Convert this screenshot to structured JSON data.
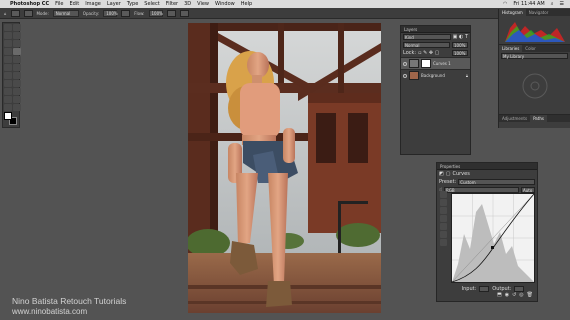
{
  "menubar": {
    "apple": "",
    "app_name": "Photoshop CC",
    "items": [
      "File",
      "Edit",
      "Image",
      "Layer",
      "Type",
      "Select",
      "Filter",
      "3D",
      "View",
      "Window",
      "Help"
    ],
    "clock": "Fri 11:44 AM"
  },
  "options_bar": {
    "mode_label": "Mode:",
    "mode_value": "Normal",
    "opacity_label": "Opacity:",
    "opacity_value": "100%",
    "flow_label": "Flow:",
    "flow_value": "100%"
  },
  "layers_panel": {
    "title": "Layers",
    "kind": "Kind",
    "blend": "Normal",
    "opacity": "100%",
    "lock_label": "Lock:",
    "fill": "100%",
    "layers": [
      {
        "name": "Curves 1"
      },
      {
        "name": "Background"
      }
    ]
  },
  "right_dock": {
    "histogram_tabs": [
      "Histogram",
      "Navigator"
    ],
    "libraries_tabs": [
      "Libraries",
      "Color"
    ],
    "library_name": "My Library",
    "adjust_tabs": [
      "Adjustments",
      "Paths"
    ]
  },
  "properties": {
    "title": "Properties",
    "panel_name": "Curves",
    "preset_label": "Preset:",
    "preset_value": "Custom",
    "channel": "RGB",
    "auto": "Auto",
    "input_label": "Input:",
    "output_label": "Output:"
  },
  "watermark": {
    "title": "Nino Batista Retouch Tutorials",
    "url": "www.ninobatista.com"
  },
  "colors": {
    "ui_dark": "#3d3d3d",
    "workspace": "#535353",
    "menubar": "#dcdcdc"
  }
}
